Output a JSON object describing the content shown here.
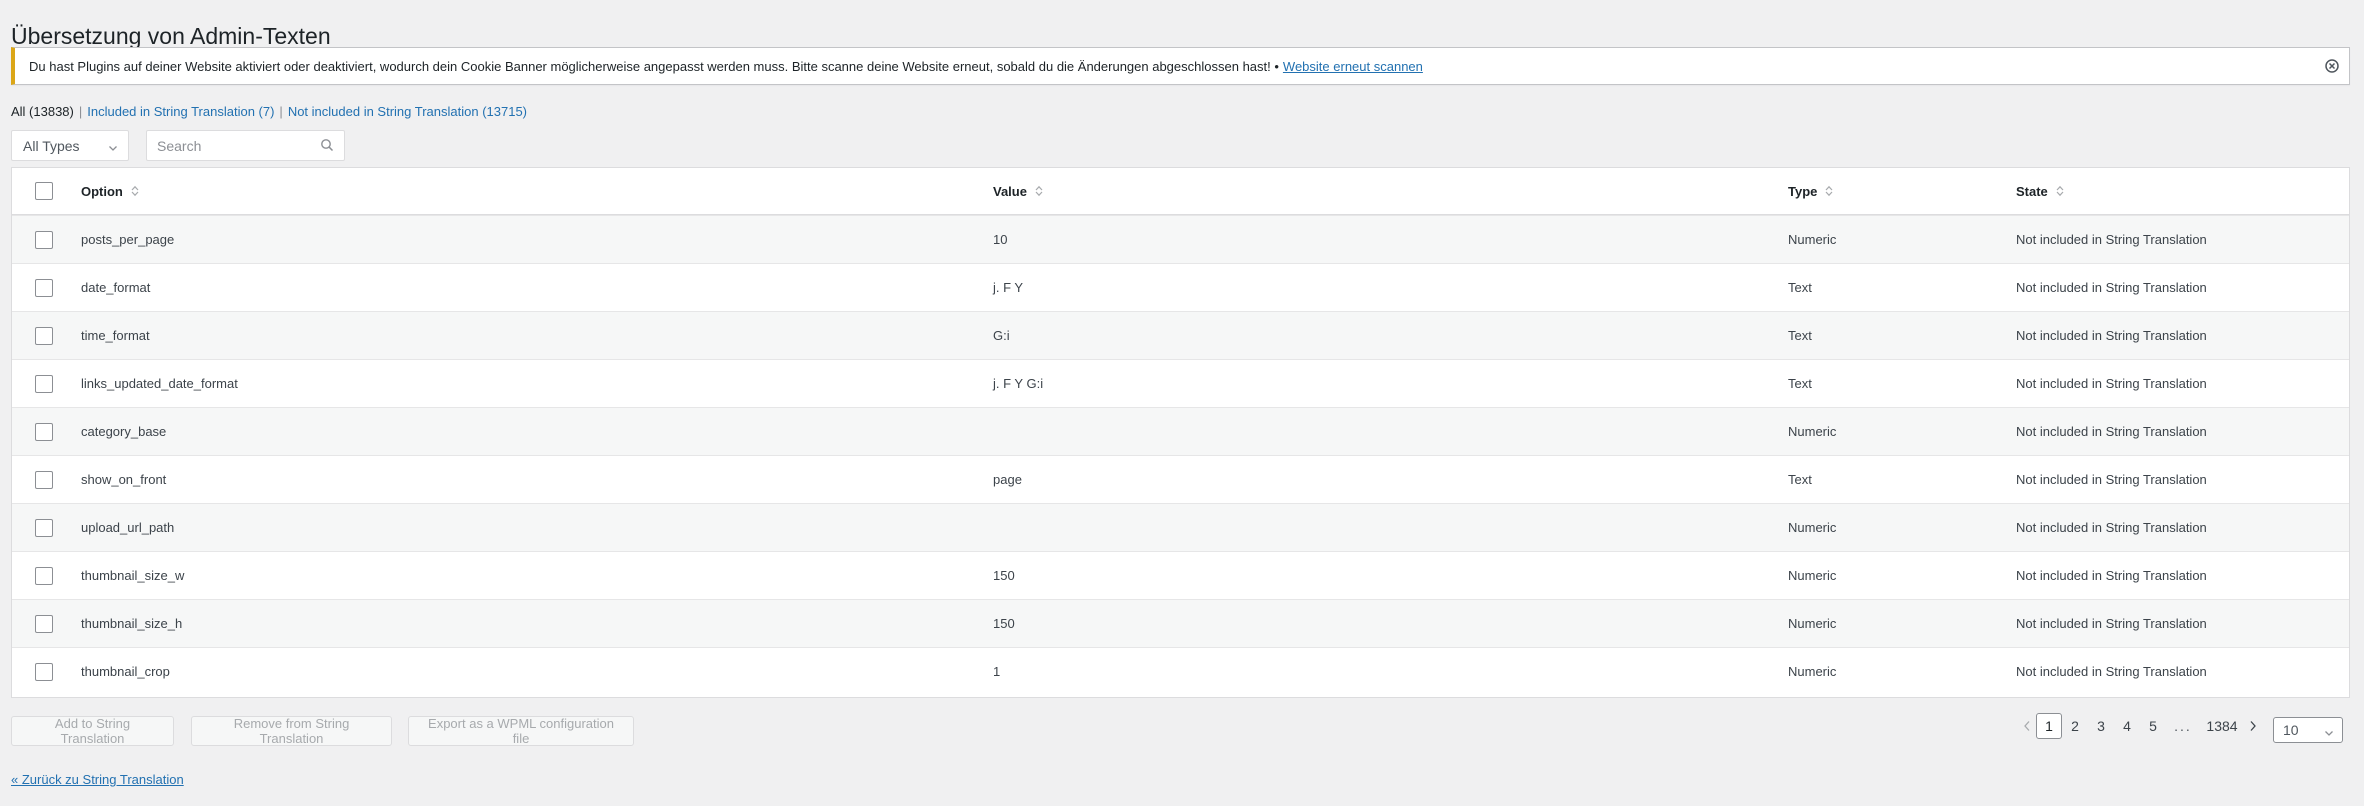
{
  "page": {
    "title": "Übersetzung von Admin-Texten"
  },
  "notice": {
    "text": "Du hast Plugins auf deiner Website aktiviert oder deaktiviert, wodurch dein Cookie Banner möglicherweise angepasst werden muss. Bitte scanne deine Website erneut, sobald du die Änderungen abgeschlossen hast! •",
    "link": "Website erneut scannen",
    "close_icon": "close-circle-icon"
  },
  "views": {
    "all": "All (13838)",
    "included": "Included in String Translation (7)",
    "not_included": "Not included in String Translation (13715)"
  },
  "filters": {
    "type_selected": "All Types",
    "search_placeholder": "Search",
    "search_value": ""
  },
  "table": {
    "columns": {
      "option": "Option",
      "value": "Value",
      "type": "Type",
      "state": "State"
    },
    "rows": [
      {
        "option": "posts_per_page",
        "value": "10",
        "type": "Numeric",
        "state": "Not included in String Translation"
      },
      {
        "option": "date_format",
        "value": "j. F Y",
        "type": "Text",
        "state": "Not included in String Translation"
      },
      {
        "option": "time_format",
        "value": "G:i",
        "type": "Text",
        "state": "Not included in String Translation"
      },
      {
        "option": "links_updated_date_format",
        "value": "j. F Y G:i",
        "type": "Text",
        "state": "Not included in String Translation"
      },
      {
        "option": "category_base",
        "value": "",
        "type": "Numeric",
        "state": "Not included in String Translation"
      },
      {
        "option": "show_on_front",
        "value": "page",
        "type": "Text",
        "state": "Not included in String Translation"
      },
      {
        "option": "upload_url_path",
        "value": "",
        "type": "Numeric",
        "state": "Not included in String Translation"
      },
      {
        "option": "thumbnail_size_w",
        "value": "150",
        "type": "Numeric",
        "state": "Not included in String Translation"
      },
      {
        "option": "thumbnail_size_h",
        "value": "150",
        "type": "Numeric",
        "state": "Not included in String Translation"
      },
      {
        "option": "thumbnail_crop",
        "value": "1",
        "type": "Numeric",
        "state": "Not included in String Translation"
      }
    ]
  },
  "actions": {
    "add": "Add to String Translation",
    "remove": "Remove from String Translation",
    "export": "Export as a WPML configuration file"
  },
  "pagination": {
    "pages": [
      "1",
      "2",
      "3",
      "4",
      "5"
    ],
    "current": "1",
    "ellipsis": "...",
    "last": "1384",
    "per_page": "10"
  },
  "back_link": "« Zurück zu String Translation"
}
